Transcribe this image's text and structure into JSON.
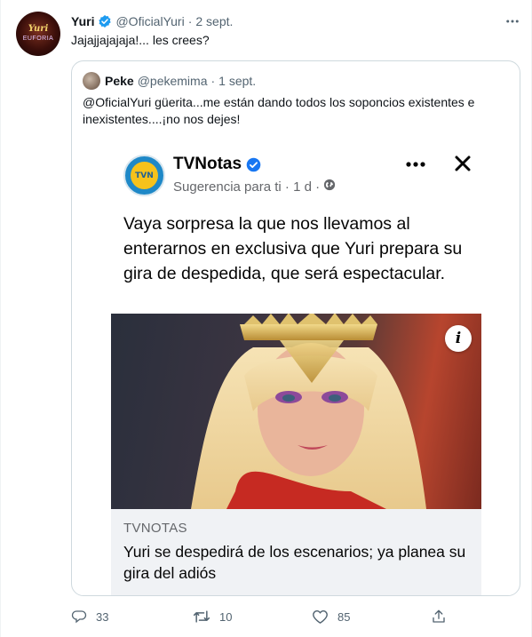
{
  "tweet": {
    "author_name": "Yuri",
    "author_handle": "@OficialYuri",
    "separator": "·",
    "date": "2 sept.",
    "text": "Jajajjajajaja!... les crees?",
    "avatar_text": "Yuri",
    "avatar_subtext": "EUFORIA"
  },
  "quote": {
    "author_name": "Peke",
    "author_handle": "@pekemima",
    "separator": "·",
    "date": "1 sept.",
    "text": "@OficialYuri güerita...me están dando todos los soponcios existentes e inexistentes....¡no nos dejes!"
  },
  "facebook_post": {
    "page_name": "TVNotas",
    "logo_text": "TVN",
    "subtitle": "Sugerencia para ti · 1 d ·",
    "body": "Vaya sorpresa la que nos llevamos al enterarnos en exclusiva que Yuri prepara su gira de despedida, que será espectacular.",
    "info_label": "i",
    "link_domain": "TVNOTAS",
    "link_headline": "Yuri se despedirá de los escenarios; ya planea su gira del adiós"
  },
  "actions": {
    "replies": "33",
    "retweets": "10",
    "likes": "85"
  },
  "colors": {
    "verified_blue": "#1d9bf0",
    "muted": "#536471",
    "border": "#cfd9de",
    "fb_link_bg": "#f0f2f5"
  }
}
